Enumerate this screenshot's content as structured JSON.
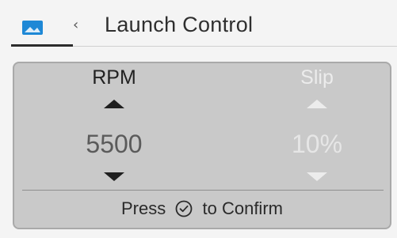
{
  "header": {
    "icon": "image-icon",
    "back_icon": "chevron-left-icon",
    "title": "Launch Control"
  },
  "controls": [
    {
      "label": "RPM",
      "value": "5500",
      "enabled": true
    },
    {
      "label": "Slip",
      "value": "10%",
      "enabled": false
    }
  ],
  "footer": {
    "prefix": "Press",
    "icon": "check-circle-icon",
    "suffix": "to Confirm"
  },
  "colors": {
    "background": "#f4f4f4",
    "panel": "#c9c9c9",
    "accent_icon": "#1e88d6",
    "active_text": "#222222",
    "disabled_text": "#ececec"
  }
}
